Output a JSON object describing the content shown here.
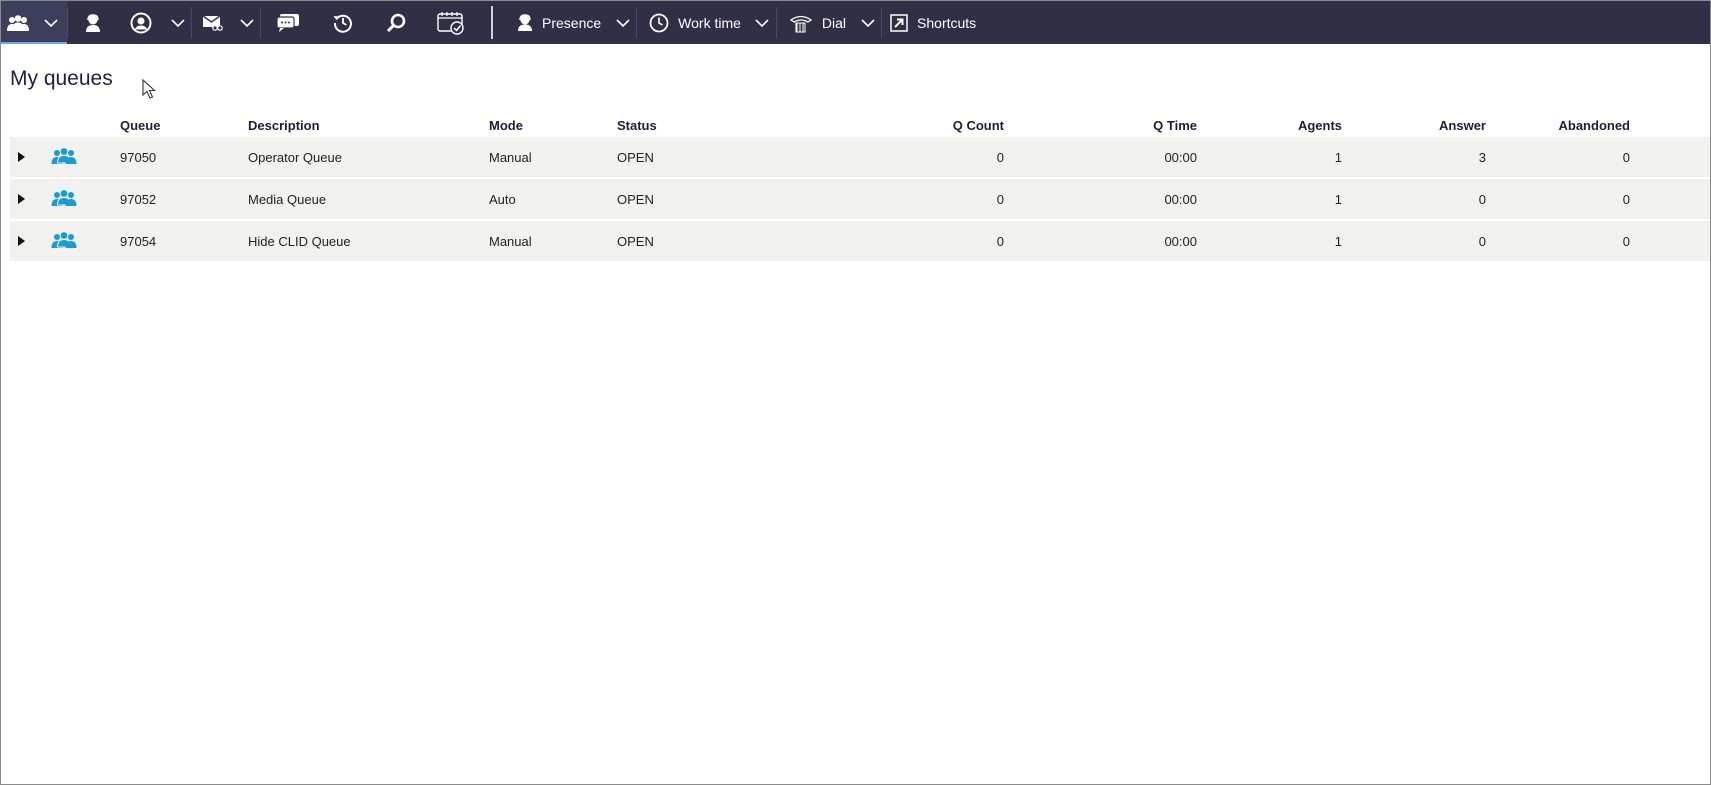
{
  "toolbar": {
    "presence_label": "Presence",
    "worktime_label": "Work time",
    "dial_label": "Dial",
    "shortcuts_label": "Shortcuts"
  },
  "page": {
    "title": "My queues"
  },
  "table": {
    "headers": {
      "queue": "Queue",
      "description": "Description",
      "mode": "Mode",
      "status": "Status",
      "qcount": "Q Count",
      "qtime": "Q Time",
      "agents": "Agents",
      "answer": "Answer",
      "abandoned": "Abandoned"
    },
    "rows": [
      {
        "queue": "97050",
        "description": "Operator Queue",
        "mode": "Manual",
        "status": "OPEN",
        "qcount": "0",
        "qtime": "00:00",
        "agents": "1",
        "answer": "3",
        "abandoned": "0"
      },
      {
        "queue": "97052",
        "description": "Media Queue",
        "mode": "Auto",
        "status": "OPEN",
        "qcount": "0",
        "qtime": "00:00",
        "agents": "1",
        "answer": "0",
        "abandoned": "0"
      },
      {
        "queue": "97054",
        "description": "Hide CLID Queue",
        "mode": "Manual",
        "status": "OPEN",
        "qcount": "0",
        "qtime": "00:00",
        "agents": "1",
        "answer": "0",
        "abandoned": "0"
      }
    ]
  },
  "colors": {
    "toolbar_bg": "#2f3046",
    "accent": "#1a9ad6",
    "row_bg": "#f1f1ef"
  },
  "icons": [
    "queues-icon",
    "chevron-down-icon",
    "agent-icon",
    "contact-icon",
    "voicemail-icon",
    "chat-icon",
    "history-icon",
    "search-icon",
    "calendar-check-icon",
    "presence-icon",
    "clock-icon",
    "phone-icon",
    "shortcut-icon",
    "queue-group-icon",
    "expand-caret-icon"
  ]
}
